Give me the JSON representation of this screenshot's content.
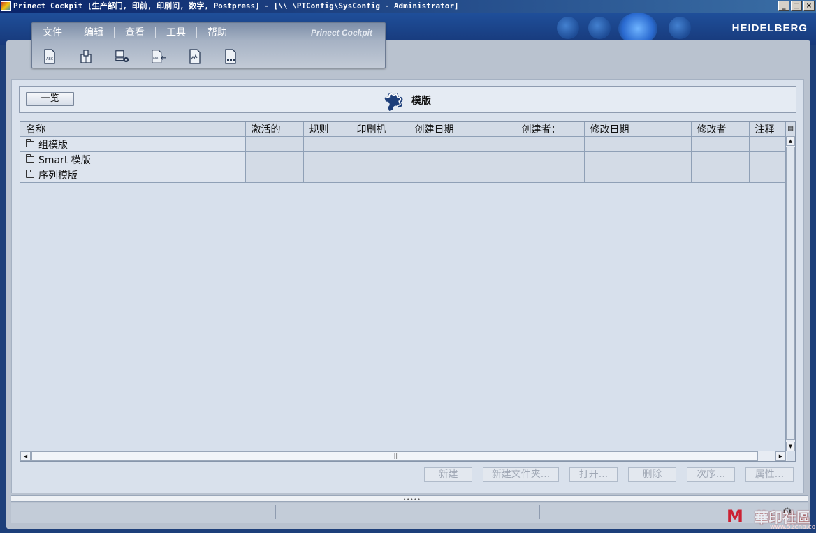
{
  "window": {
    "title": "Prinect Cockpit [生产部门, 印前, 印刷间, 数字, Postpress] - [\\\\                \\PTConfig\\SysConfig - Administrator]",
    "controls": [
      "_",
      "□",
      "×"
    ]
  },
  "header": {
    "brand": "HEIDELBERG"
  },
  "menu": {
    "items": [
      "文件",
      "编辑",
      "查看",
      "工具",
      "帮助"
    ],
    "product_label": "Prinect Cockpit"
  },
  "toolbar": {
    "icons": [
      "job-template-icon",
      "printing-press-icon",
      "system-config-icon",
      "import-abc-icon",
      "report-icon",
      "sequence-icon"
    ]
  },
  "subheader": {
    "overview_button": "一览",
    "title": "模版",
    "icon": "puzzle-icon"
  },
  "table": {
    "columns": [
      "名称",
      "激活的",
      "规则",
      "印刷机",
      "创建日期",
      "创建者：",
      "修改日期",
      "修改者",
      "注释"
    ],
    "rows": [
      {
        "name": "组模版",
        "icon": "folder-icon"
      },
      {
        "name": "Smart 模版",
        "icon": "folder-icon"
      },
      {
        "name": "序列模版",
        "icon": "folder-icon"
      }
    ]
  },
  "actions": {
    "new": "新建",
    "new_folder": "新建文件夹...",
    "open": "打开...",
    "delete": "删除",
    "sequence": "次序...",
    "properties": "属性..."
  },
  "watermark": {
    "title": "華印社區",
    "url": "www.52cnp.com"
  },
  "colors": {
    "header_blue": "#1f4f9a",
    "panel_bg": "#d9e1ec",
    "disabled_text": "#a0a8b5"
  }
}
